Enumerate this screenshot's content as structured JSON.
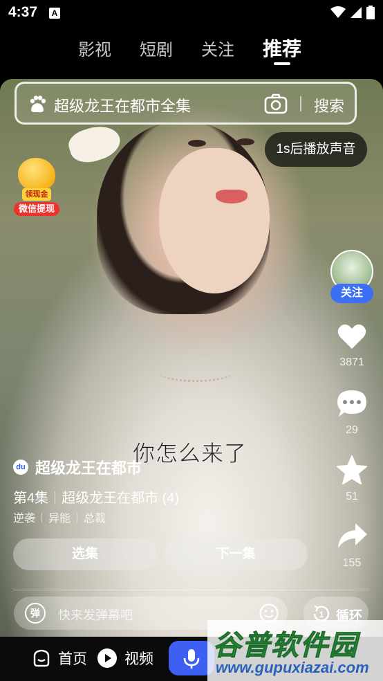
{
  "status_bar": {
    "time": "4:37",
    "notification_icon": "A"
  },
  "top_tabs": [
    "影视",
    "短剧",
    "关注",
    "推荐"
  ],
  "active_tab": "推荐",
  "search": {
    "query": "超级龙王在都市全集",
    "button": "搜索"
  },
  "sound_tip": "1s后播放声音",
  "reward_widget": {
    "tag": "领现金",
    "label": "微信提现"
  },
  "author": {
    "follow_label": "关注"
  },
  "actions": {
    "like_count": "3871",
    "comment_count": "29",
    "favorite_count": "51",
    "share_count": "155"
  },
  "subtitle": "你怎么来了",
  "drama": {
    "badge": "du",
    "title": "超级龙王在都市",
    "episode": "第4集",
    "series": "超级龙王在都市 (4)",
    "tags": [
      "逆袭",
      "异能",
      "总裁"
    ]
  },
  "buttons": {
    "select_episode": "选集",
    "next_episode": "下一集"
  },
  "danmaku": {
    "icon_label": "弹",
    "placeholder": "快来发弹幕吧"
  },
  "loop": {
    "icon_label": "1",
    "label": "循环"
  },
  "bottom_nav": {
    "home": "首页",
    "video": "视频"
  },
  "watermark": {
    "main": "谷普软件园",
    "url": "www.gupuxiazai.com"
  },
  "colors": {
    "accent_blue": "#3d60f2",
    "follow_blue": "#3d6ff5",
    "reward_red": "#f0302a",
    "reward_gold": "#f6b51d"
  }
}
